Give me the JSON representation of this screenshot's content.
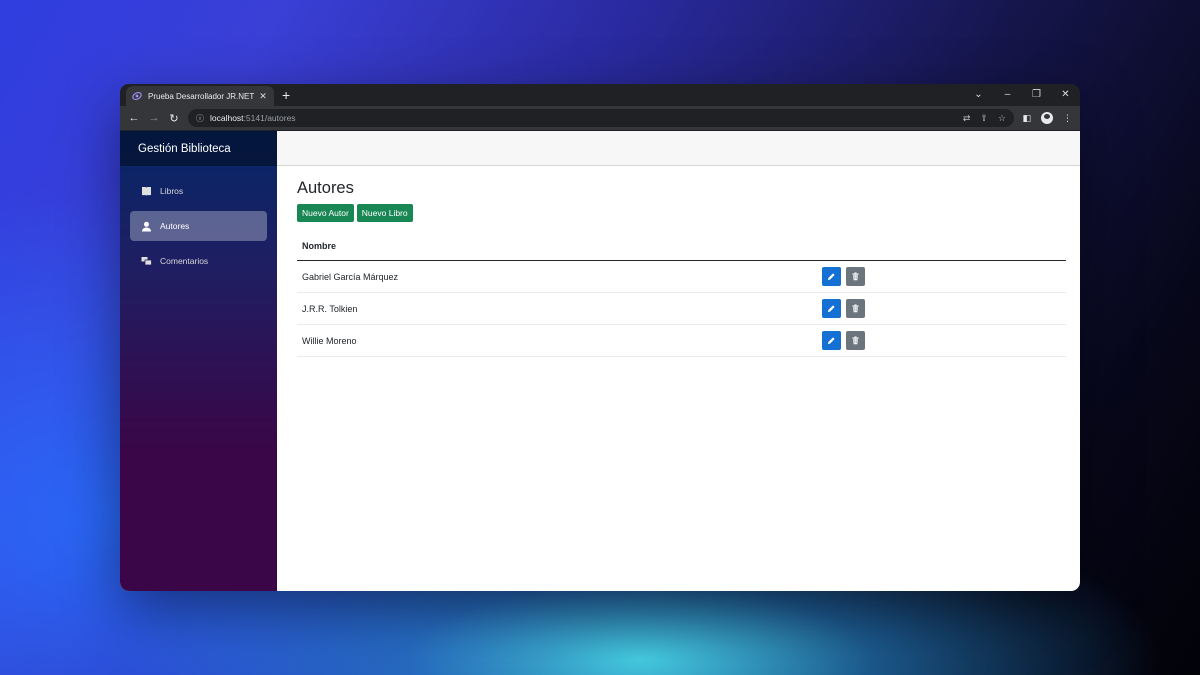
{
  "browser": {
    "tab_title": "Prueba Desarrollador JR.NET",
    "tab_close": "✕",
    "new_tab": "+",
    "url_host": "localhost",
    "url_path": ":5141/autores",
    "controls": {
      "collapse": "⌄",
      "minimize": "–",
      "restore": "❐",
      "close": "✕"
    }
  },
  "app": {
    "brand": "Gestión Biblioteca",
    "nav": [
      {
        "label": "Libros",
        "icon": "book-icon"
      },
      {
        "label": "Autores",
        "icon": "person-icon",
        "active": true
      },
      {
        "label": "Comentarios",
        "icon": "comments-icon"
      }
    ]
  },
  "main": {
    "title": "Autores",
    "buttons": {
      "new_author": "Nuevo Autor",
      "new_book": "Nuevo Libro"
    },
    "table": {
      "header": "Nombre",
      "rows": [
        {
          "name": "Gabriel García Márquez"
        },
        {
          "name": "J.R.R. Tolkien"
        },
        {
          "name": "Willie Moreno"
        }
      ]
    }
  },
  "colors": {
    "success": "#198754",
    "edit": "#1570d4",
    "delete": "#6c757d"
  }
}
